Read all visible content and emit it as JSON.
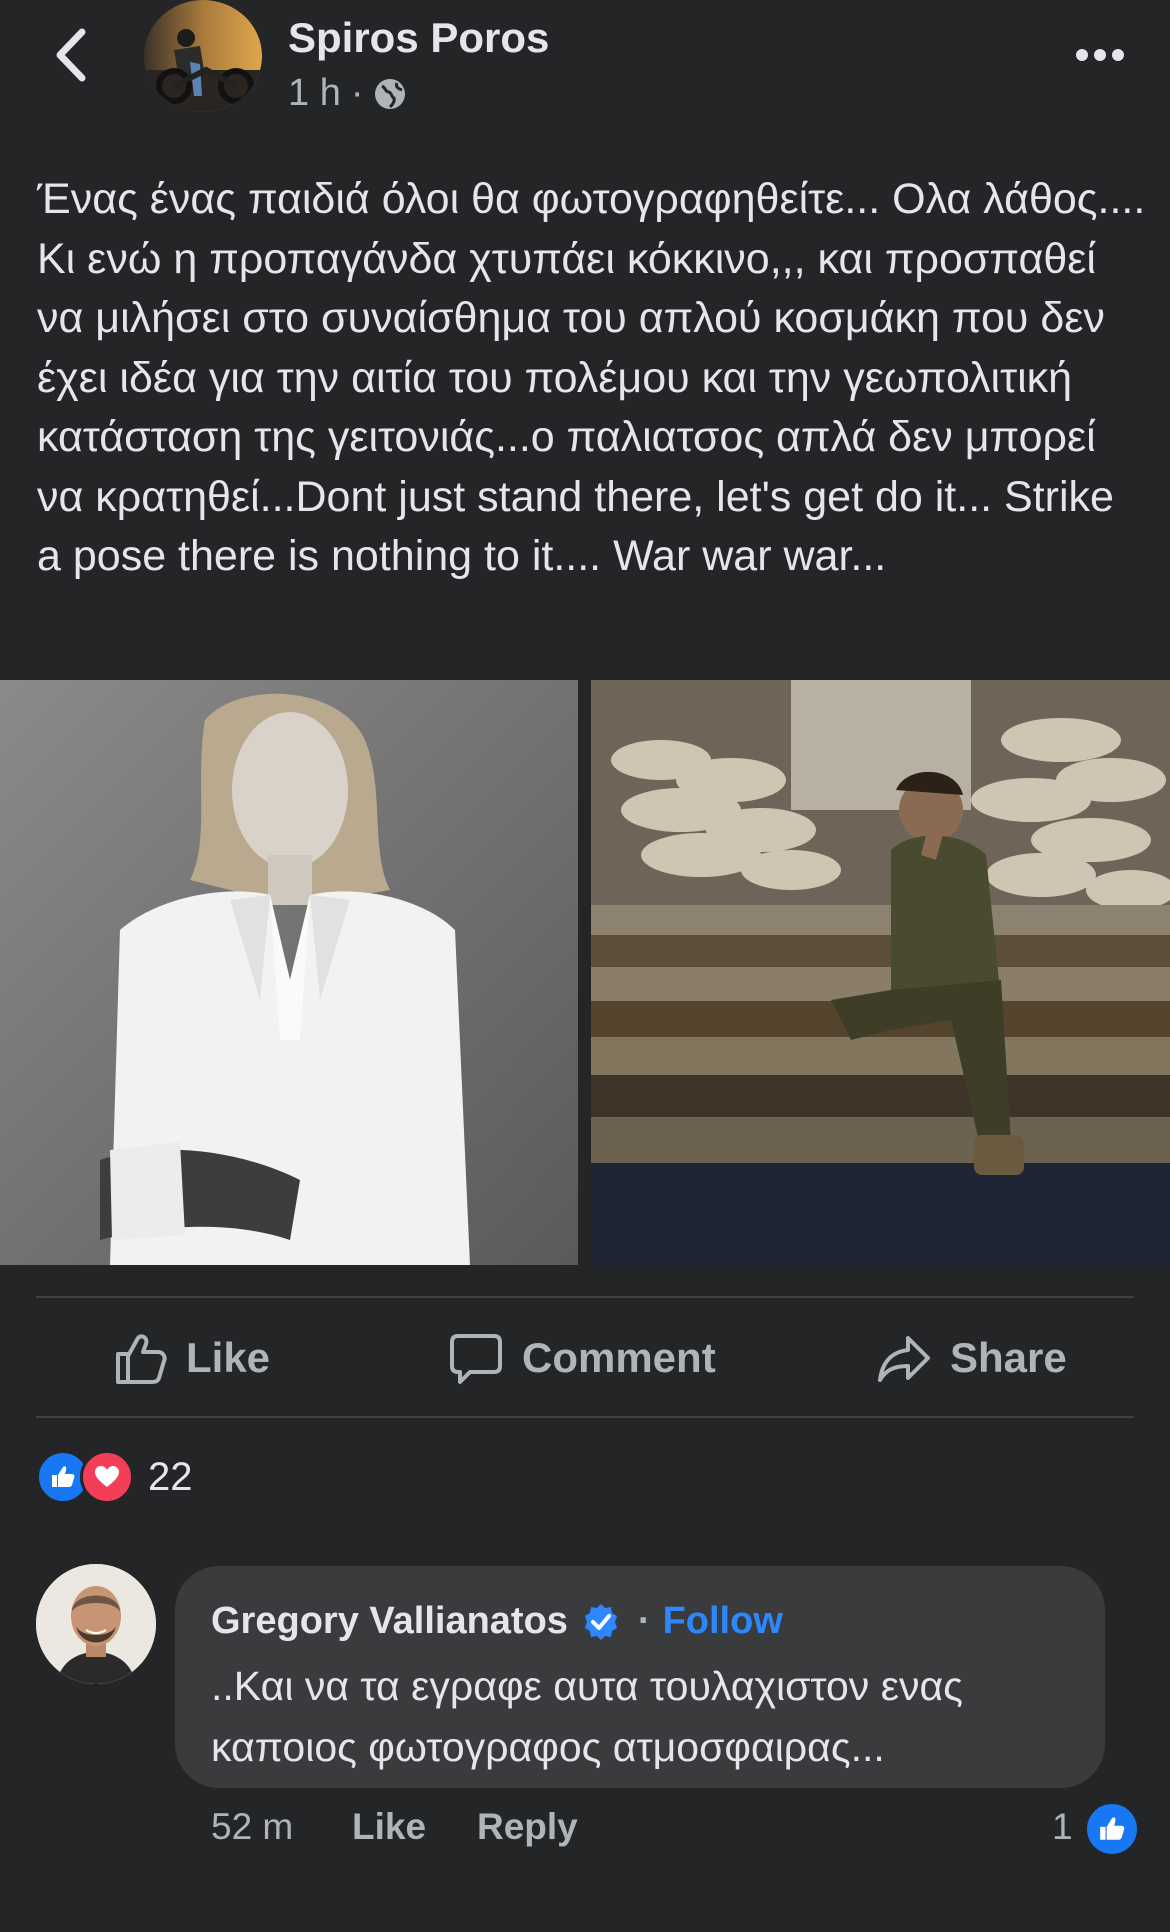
{
  "post": {
    "author": "Spiros Poros",
    "time": "1 h",
    "meta_separator": "·",
    "audience_icon": "globe-icon",
    "text": "Ένας ένας παιδιά όλοι θα φωτογραφηθείτε... Ολα λάθος.... Κι ενώ η προπαγάνδα χτυπάει κόκκινο,,, και προσπαθεί να μιλήσει στο συναίσθημα του απλού κοσμάκη που δεν έχει ιδέα για την αιτία του πολέμου και την γεωπολιτική κατάσταση της γειτονιάς...ο παλιατσος απλά δεν μπορεί να κρατηθεί...Dont just stand there, let's get do it... Strike a pose there is nothing to it.... War war war..."
  },
  "actions": {
    "like": "Like",
    "comment": "Comment",
    "share": "Share"
  },
  "reactions": {
    "count": "22",
    "icons": [
      "like-reaction-icon",
      "love-reaction-icon"
    ],
    "colors": {
      "like": "#1877f2",
      "love": "#f33e58"
    }
  },
  "comment": {
    "author": "Gregory Vallianatos",
    "separator": "·",
    "follow": "Follow",
    "text": "..Και να τα εγραφε αυτα τουλαχιστον ενας καποιος φωτογραφος ατμοσφαιρας...",
    "time": "52 m",
    "like": "Like",
    "reply": "Reply",
    "reaction_count": "1"
  },
  "colors": {
    "background": "#242526",
    "bubble": "#3a3b3c",
    "primary_text": "#e4e6eb",
    "secondary_text": "#b0b3b8",
    "accent": "#2d88ff"
  }
}
